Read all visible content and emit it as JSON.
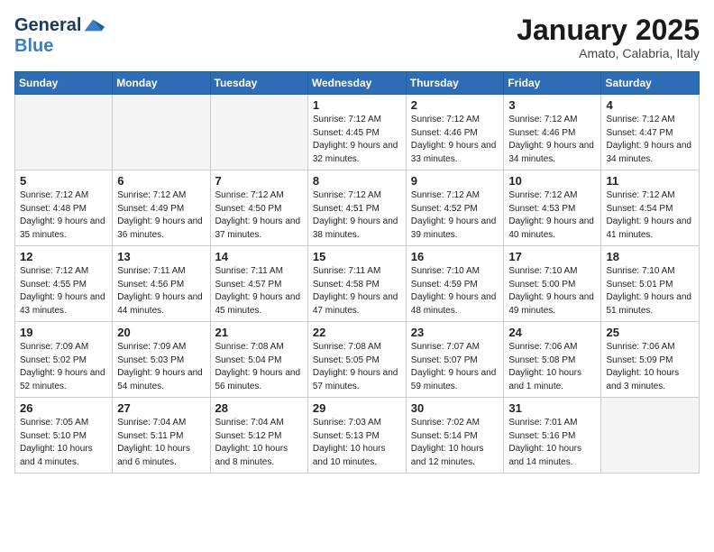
{
  "header": {
    "logo_line1": "General",
    "logo_line2": "Blue",
    "month": "January 2025",
    "location": "Amato, Calabria, Italy"
  },
  "weekdays": [
    "Sunday",
    "Monday",
    "Tuesday",
    "Wednesday",
    "Thursday",
    "Friday",
    "Saturday"
  ],
  "weeks": [
    [
      {
        "day": "",
        "info": ""
      },
      {
        "day": "",
        "info": ""
      },
      {
        "day": "",
        "info": ""
      },
      {
        "day": "1",
        "info": "Sunrise: 7:12 AM\nSunset: 4:45 PM\nDaylight: 9 hours and 32 minutes."
      },
      {
        "day": "2",
        "info": "Sunrise: 7:12 AM\nSunset: 4:46 PM\nDaylight: 9 hours and 33 minutes."
      },
      {
        "day": "3",
        "info": "Sunrise: 7:12 AM\nSunset: 4:46 PM\nDaylight: 9 hours and 34 minutes."
      },
      {
        "day": "4",
        "info": "Sunrise: 7:12 AM\nSunset: 4:47 PM\nDaylight: 9 hours and 34 minutes."
      }
    ],
    [
      {
        "day": "5",
        "info": "Sunrise: 7:12 AM\nSunset: 4:48 PM\nDaylight: 9 hours and 35 minutes."
      },
      {
        "day": "6",
        "info": "Sunrise: 7:12 AM\nSunset: 4:49 PM\nDaylight: 9 hours and 36 minutes."
      },
      {
        "day": "7",
        "info": "Sunrise: 7:12 AM\nSunset: 4:50 PM\nDaylight: 9 hours and 37 minutes."
      },
      {
        "day": "8",
        "info": "Sunrise: 7:12 AM\nSunset: 4:51 PM\nDaylight: 9 hours and 38 minutes."
      },
      {
        "day": "9",
        "info": "Sunrise: 7:12 AM\nSunset: 4:52 PM\nDaylight: 9 hours and 39 minutes."
      },
      {
        "day": "10",
        "info": "Sunrise: 7:12 AM\nSunset: 4:53 PM\nDaylight: 9 hours and 40 minutes."
      },
      {
        "day": "11",
        "info": "Sunrise: 7:12 AM\nSunset: 4:54 PM\nDaylight: 9 hours and 41 minutes."
      }
    ],
    [
      {
        "day": "12",
        "info": "Sunrise: 7:12 AM\nSunset: 4:55 PM\nDaylight: 9 hours and 43 minutes."
      },
      {
        "day": "13",
        "info": "Sunrise: 7:11 AM\nSunset: 4:56 PM\nDaylight: 9 hours and 44 minutes."
      },
      {
        "day": "14",
        "info": "Sunrise: 7:11 AM\nSunset: 4:57 PM\nDaylight: 9 hours and 45 minutes."
      },
      {
        "day": "15",
        "info": "Sunrise: 7:11 AM\nSunset: 4:58 PM\nDaylight: 9 hours and 47 minutes."
      },
      {
        "day": "16",
        "info": "Sunrise: 7:10 AM\nSunset: 4:59 PM\nDaylight: 9 hours and 48 minutes."
      },
      {
        "day": "17",
        "info": "Sunrise: 7:10 AM\nSunset: 5:00 PM\nDaylight: 9 hours and 49 minutes."
      },
      {
        "day": "18",
        "info": "Sunrise: 7:10 AM\nSunset: 5:01 PM\nDaylight: 9 hours and 51 minutes."
      }
    ],
    [
      {
        "day": "19",
        "info": "Sunrise: 7:09 AM\nSunset: 5:02 PM\nDaylight: 9 hours and 52 minutes."
      },
      {
        "day": "20",
        "info": "Sunrise: 7:09 AM\nSunset: 5:03 PM\nDaylight: 9 hours and 54 minutes."
      },
      {
        "day": "21",
        "info": "Sunrise: 7:08 AM\nSunset: 5:04 PM\nDaylight: 9 hours and 56 minutes."
      },
      {
        "day": "22",
        "info": "Sunrise: 7:08 AM\nSunset: 5:05 PM\nDaylight: 9 hours and 57 minutes."
      },
      {
        "day": "23",
        "info": "Sunrise: 7:07 AM\nSunset: 5:07 PM\nDaylight: 9 hours and 59 minutes."
      },
      {
        "day": "24",
        "info": "Sunrise: 7:06 AM\nSunset: 5:08 PM\nDaylight: 10 hours and 1 minute."
      },
      {
        "day": "25",
        "info": "Sunrise: 7:06 AM\nSunset: 5:09 PM\nDaylight: 10 hours and 3 minutes."
      }
    ],
    [
      {
        "day": "26",
        "info": "Sunrise: 7:05 AM\nSunset: 5:10 PM\nDaylight: 10 hours and 4 minutes."
      },
      {
        "day": "27",
        "info": "Sunrise: 7:04 AM\nSunset: 5:11 PM\nDaylight: 10 hours and 6 minutes."
      },
      {
        "day": "28",
        "info": "Sunrise: 7:04 AM\nSunset: 5:12 PM\nDaylight: 10 hours and 8 minutes."
      },
      {
        "day": "29",
        "info": "Sunrise: 7:03 AM\nSunset: 5:13 PM\nDaylight: 10 hours and 10 minutes."
      },
      {
        "day": "30",
        "info": "Sunrise: 7:02 AM\nSunset: 5:14 PM\nDaylight: 10 hours and 12 minutes."
      },
      {
        "day": "31",
        "info": "Sunrise: 7:01 AM\nSunset: 5:16 PM\nDaylight: 10 hours and 14 minutes."
      },
      {
        "day": "",
        "info": ""
      }
    ]
  ]
}
